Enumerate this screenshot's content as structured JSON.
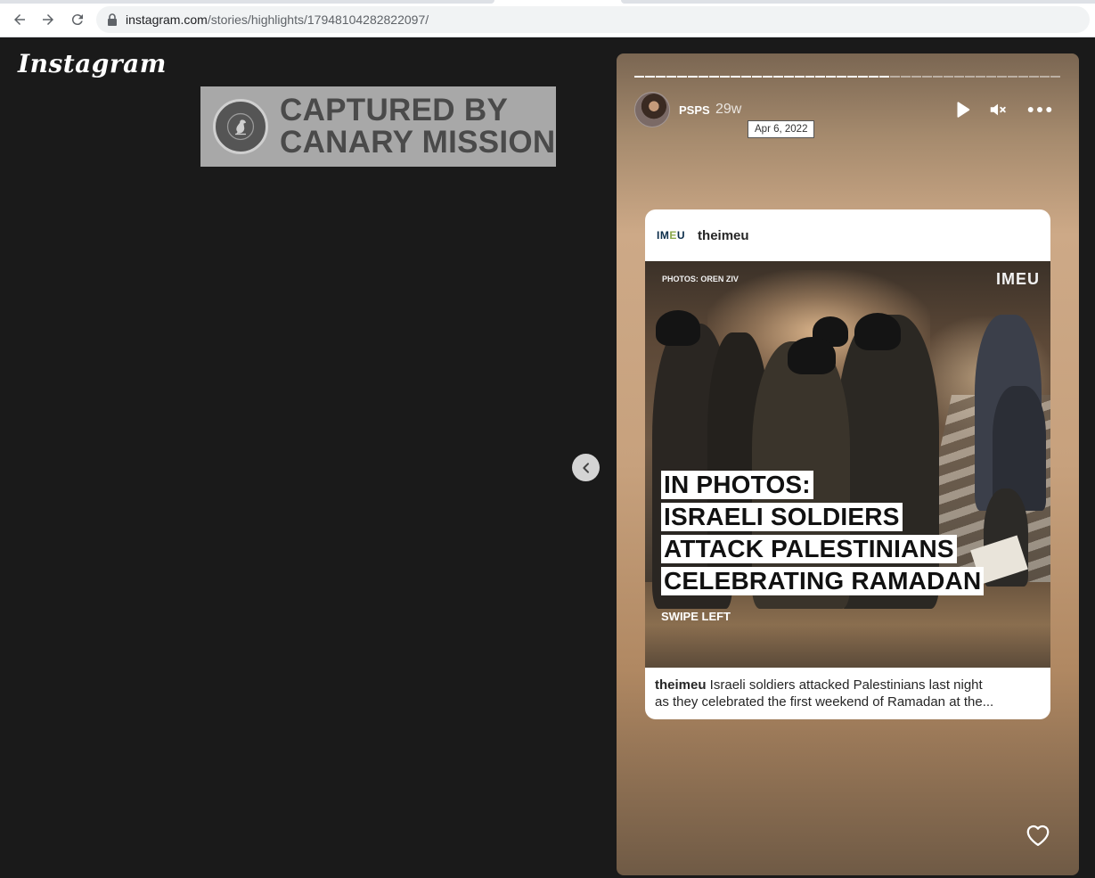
{
  "browser": {
    "url_host": "instagram.com",
    "url_path": "/stories/highlights/17948104282822097/"
  },
  "app": {
    "logo_text": "Instagram"
  },
  "watermark": {
    "line1": "CAPTURED BY",
    "line2": "CANARY MISSION"
  },
  "story": {
    "username": "PSPS",
    "time_ago": "29w",
    "date_tooltip": "Apr 6, 2022",
    "progress": {
      "segments_total": 40,
      "segments_done": 24
    },
    "controls": {
      "play_icon": "play-icon",
      "mute_icon": "muted-speaker-icon",
      "more_icon": "more-icon",
      "like_icon": "heart-icon"
    }
  },
  "post": {
    "logo_prefix": "IM",
    "logo_accent": "E",
    "logo_suffix": "U",
    "username": "theimeu",
    "photo_credit": "PHOTOS: OREN ZIV",
    "photo_brand": "IMEU",
    "headline": [
      "IN PHOTOS:",
      "ISRAELI SOLDIERS",
      "ATTACK PALESTINIANS",
      "CELEBRATING RAMADAN"
    ],
    "swipe_text": "SWIPE LEFT",
    "caption_user": "theimeu",
    "caption_line1": " Israeli soldiers attacked Palestinians last night",
    "caption_line2": "as they celebrated the first weekend of Ramadan at the..."
  },
  "colors": {
    "page_bg": "#1a1a1a",
    "watermark_bg": "#a8a8a8",
    "imeu_accent": "#8aa94a"
  }
}
